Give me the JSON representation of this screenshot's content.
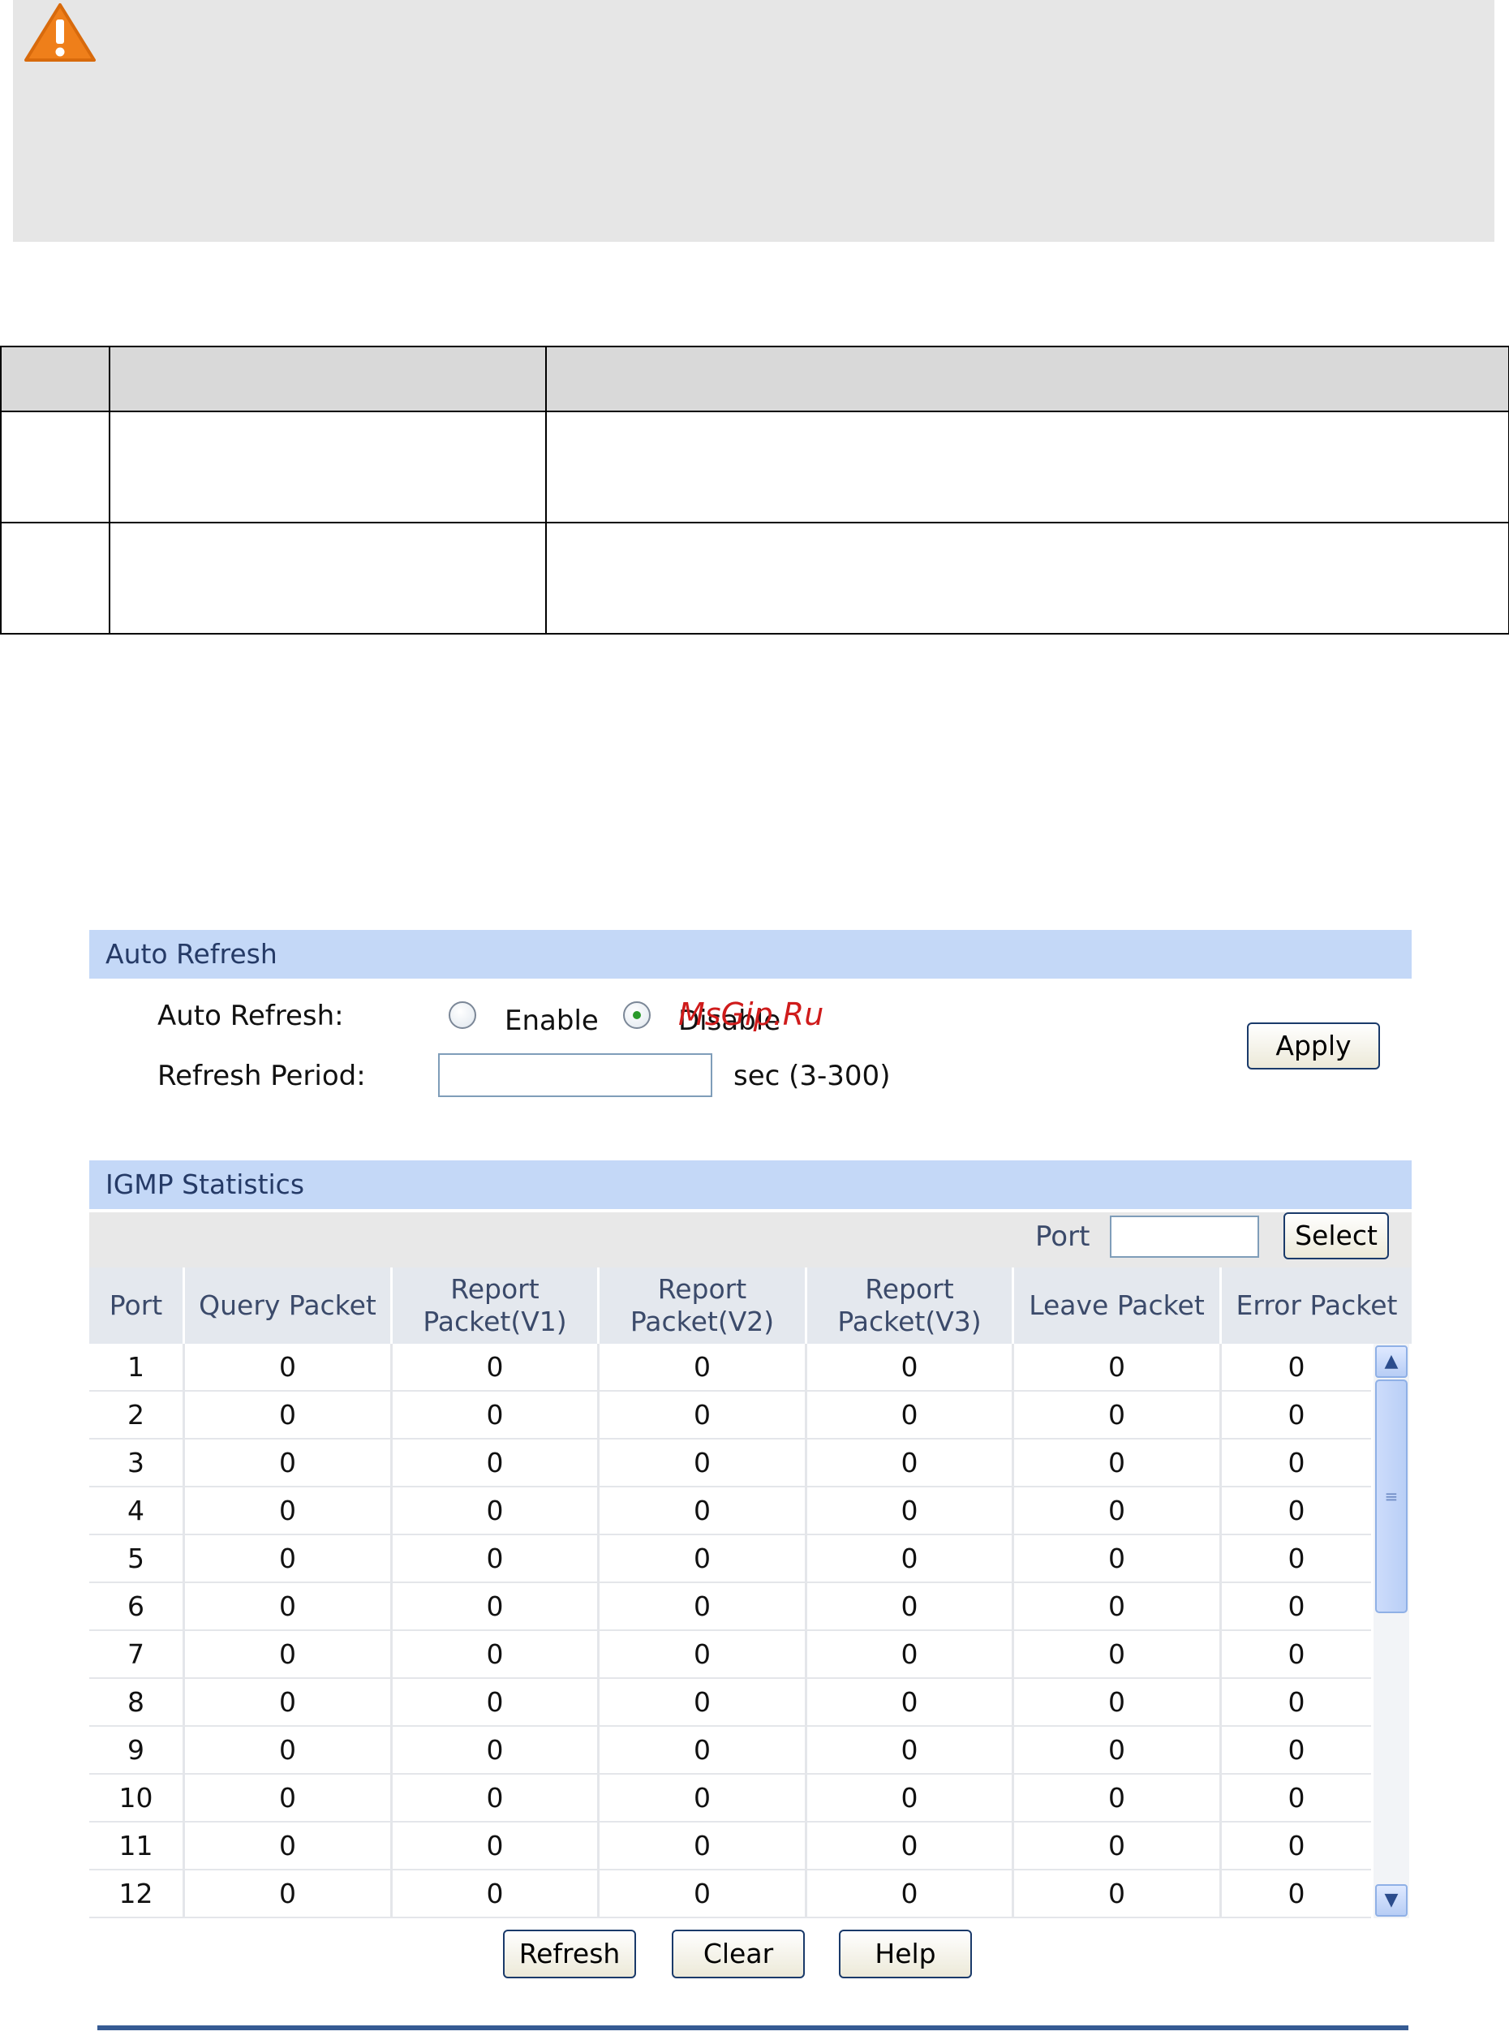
{
  "warning_box": {
    "icon": "warning-triangle-icon"
  },
  "auto_refresh": {
    "section_title": "Auto Refresh",
    "auto_refresh_label": "Auto Refresh:",
    "enable_label": "Enable",
    "disable_label": "Disable",
    "selected": "Disable",
    "refresh_period_label": "Refresh Period:",
    "refresh_period_value": "",
    "range_hint": "sec (3-300)",
    "apply_label": "Apply"
  },
  "igmp_statistics": {
    "section_title": "IGMP Statistics",
    "port_filter_label": "Port",
    "port_filter_value": "",
    "select_label": "Select",
    "columns": [
      "Port",
      "Query Packet",
      "Report\nPacket(V1)",
      "Report\nPacket(V2)",
      "Report\nPacket(V3)",
      "Leave Packet",
      "Error Packet"
    ],
    "rows": [
      [
        "1",
        "0",
        "0",
        "0",
        "0",
        "0",
        "0"
      ],
      [
        "2",
        "0",
        "0",
        "0",
        "0",
        "0",
        "0"
      ],
      [
        "3",
        "0",
        "0",
        "0",
        "0",
        "0",
        "0"
      ],
      [
        "4",
        "0",
        "0",
        "0",
        "0",
        "0",
        "0"
      ],
      [
        "5",
        "0",
        "0",
        "0",
        "0",
        "0",
        "0"
      ],
      [
        "6",
        "0",
        "0",
        "0",
        "0",
        "0",
        "0"
      ],
      [
        "7",
        "0",
        "0",
        "0",
        "0",
        "0",
        "0"
      ],
      [
        "8",
        "0",
        "0",
        "0",
        "0",
        "0",
        "0"
      ],
      [
        "9",
        "0",
        "0",
        "0",
        "0",
        "0",
        "0"
      ],
      [
        "10",
        "0",
        "0",
        "0",
        "0",
        "0",
        "0"
      ],
      [
        "11",
        "0",
        "0",
        "0",
        "0",
        "0",
        "0"
      ],
      [
        "12",
        "0",
        "0",
        "0",
        "0",
        "0",
        "0"
      ]
    ]
  },
  "actions": {
    "refresh_label": "Refresh",
    "clear_label": "Clear",
    "help_label": "Help"
  },
  "watermark_text": "MsGip.Ru"
}
